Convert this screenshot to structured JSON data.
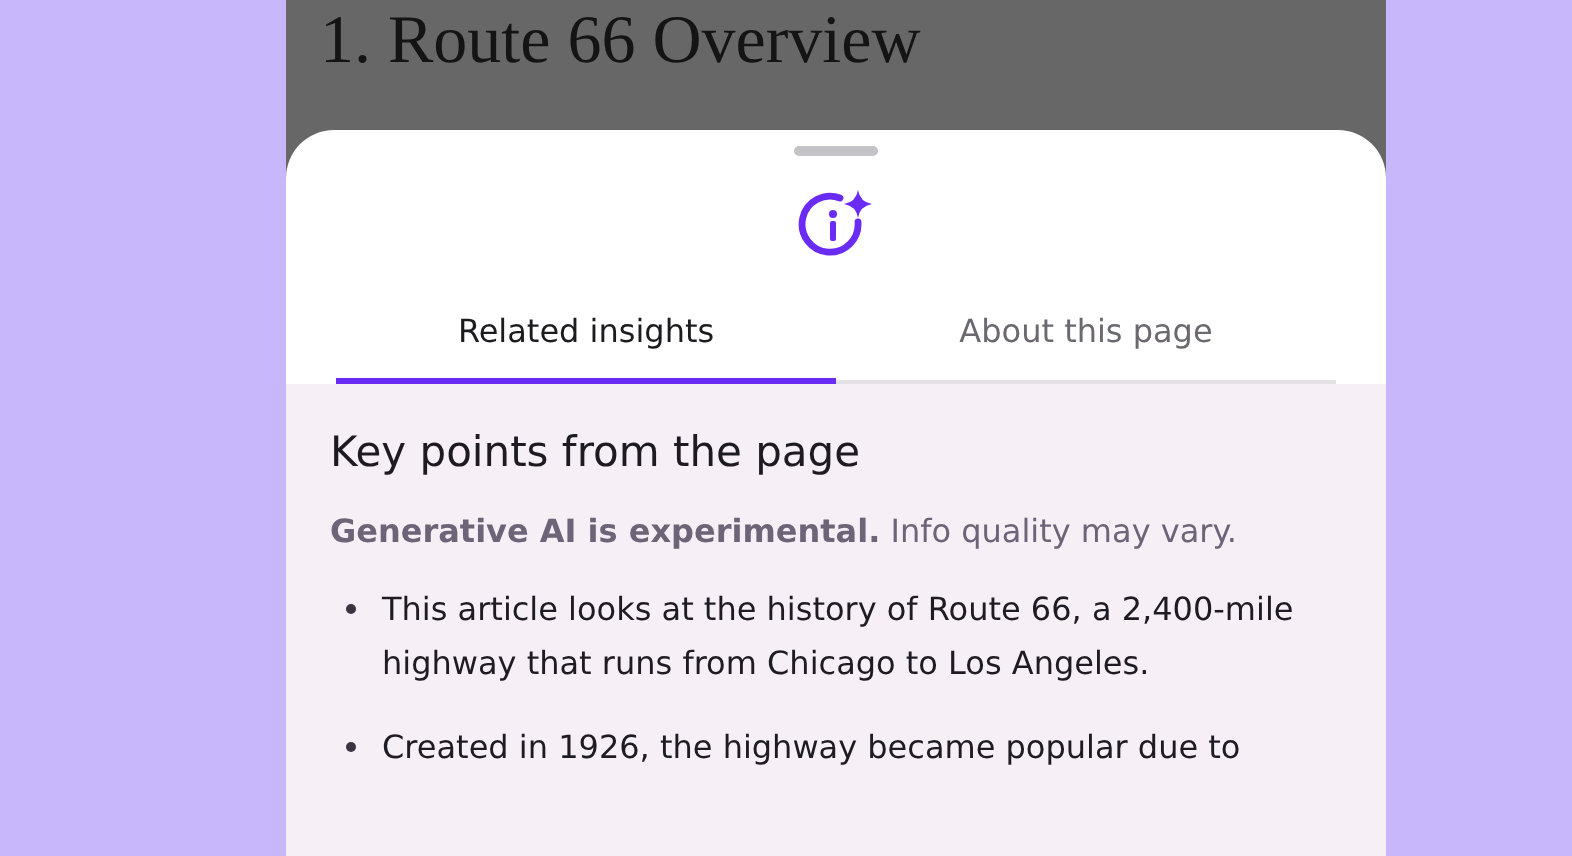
{
  "page": {
    "heading": "1. Route 66 Overview"
  },
  "sheet": {
    "tabs": [
      {
        "label": "Related insights",
        "selected": true
      },
      {
        "label": "About this page",
        "selected": false
      }
    ],
    "section_title": "Key points from the page",
    "disclaimer": "**Generative AI is experimental.** Info quality may vary.",
    "points": [
      "This article looks at the history of Route 66, a 2,400-mile highway that runs from Chicago to Los Angeles.",
      "Created in 1926, the highway became popular due to"
    ]
  }
}
